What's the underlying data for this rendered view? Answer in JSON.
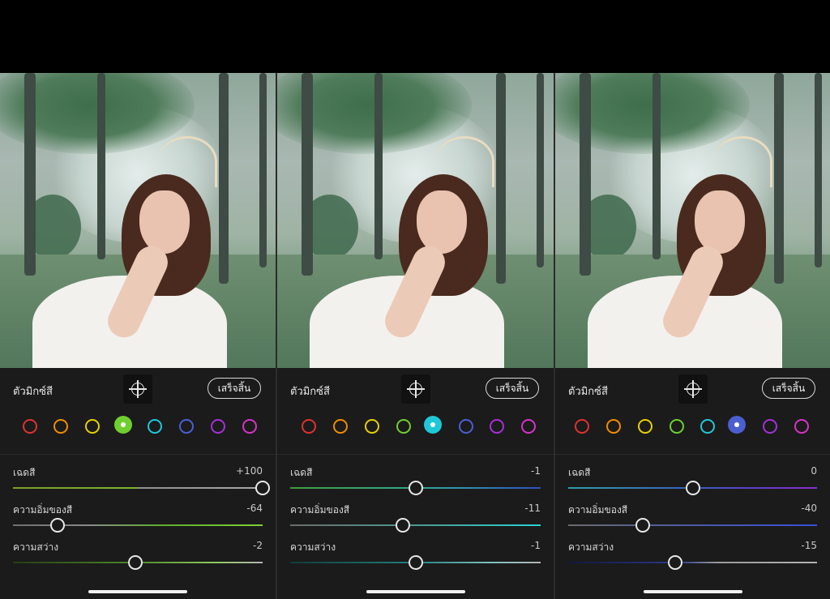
{
  "colors": {
    "background": "#1b1b1b",
    "swatch_active_ring": "#ffffff"
  },
  "panels": [
    {
      "header_label": "ตัวมิกซ์สี",
      "target_icon": "target-crosshair-icon",
      "done_label": "เสร็จสิ้น",
      "active_swatch": 3,
      "swatches": [
        "#e03131",
        "#f08c00",
        "#e6d000",
        "#6fcf30",
        "#1ec8d8",
        "#4b5fd0",
        "#a530d8",
        "#d633c9"
      ],
      "sliders": [
        {
          "label": "เฉดสี",
          "value": "+100",
          "level": 1.0,
          "track": "linear-gradient(90deg,#7a9e2a 0%,#7fb52c 50%,#8f8f8f 50%,#a8a8a8 100%)"
        },
        {
          "label": "ความอิ่มของสี",
          "value": "-64",
          "level": 0.18,
          "track": "linear-gradient(90deg,#6e6e6e 0%,#8a8a8a 30%,#5fae2f 60%,#7fd037 100%)"
        },
        {
          "label": "ความสว่าง",
          "value": "-2",
          "level": 0.49,
          "track": "linear-gradient(90deg,#253d16 0%,#4f8a2a 50%,#8fc85a 80%,#b3b3b3 100%)"
        }
      ]
    },
    {
      "header_label": "ตัวมิกซ์สี",
      "target_icon": "target-crosshair-icon",
      "done_label": "เสร็จสิ้น",
      "active_swatch": 4,
      "swatches": [
        "#e03131",
        "#f08c00",
        "#e6d000",
        "#6fcf30",
        "#1ec8d8",
        "#4b5fd0",
        "#a530d8",
        "#d633c9"
      ],
      "sliders": [
        {
          "label": "เฉดสี",
          "value": "-1",
          "level": 0.5,
          "track": "linear-gradient(90deg,#3f9e3f 0%,#2fa98d 50%,#2f8fb0 70%,#2f4fc0 100%)"
        },
        {
          "label": "ความอิ่มของสี",
          "value": "-11",
          "level": 0.45,
          "track": "linear-gradient(90deg,#6b6b6b 0%,#4c9a8f 50%,#2ad3d3 100%)"
        },
        {
          "label": "ความสว่าง",
          "value": "-1",
          "level": 0.5,
          "track": "linear-gradient(90deg,#123b3b 0%,#24807f 50%,#7fbfbf 80%,#b3b3b3 100%)"
        }
      ]
    },
    {
      "header_label": "ตัวมิกซ์สี",
      "target_icon": "target-crosshair-icon",
      "done_label": "เสร็จสิ้น",
      "active_swatch": 5,
      "swatches": [
        "#e03131",
        "#f08c00",
        "#e6d000",
        "#6fcf30",
        "#1ec8d8",
        "#4b5fd0",
        "#a530d8",
        "#d633c9"
      ],
      "sliders": [
        {
          "label": "เฉดสี",
          "value": "0",
          "level": 0.5,
          "track": "linear-gradient(90deg,#2f9ea8 0%,#3a5fc0 50%,#5c3fc8 75%,#8a2fc8 100%)"
        },
        {
          "label": "ความอิ่มของสี",
          "value": "-40",
          "level": 0.3,
          "track": "linear-gradient(90deg,#6b6b6b 0%,#4e5aa8 50%,#3a4fd8 100%)"
        },
        {
          "label": "ความสว่าง",
          "value": "-15",
          "level": 0.43,
          "track": "linear-gradient(90deg,#12163b 0%,#2a3a8a 45%,#9a9a9a 60%,#b3b3b3 100%)"
        }
      ]
    }
  ]
}
